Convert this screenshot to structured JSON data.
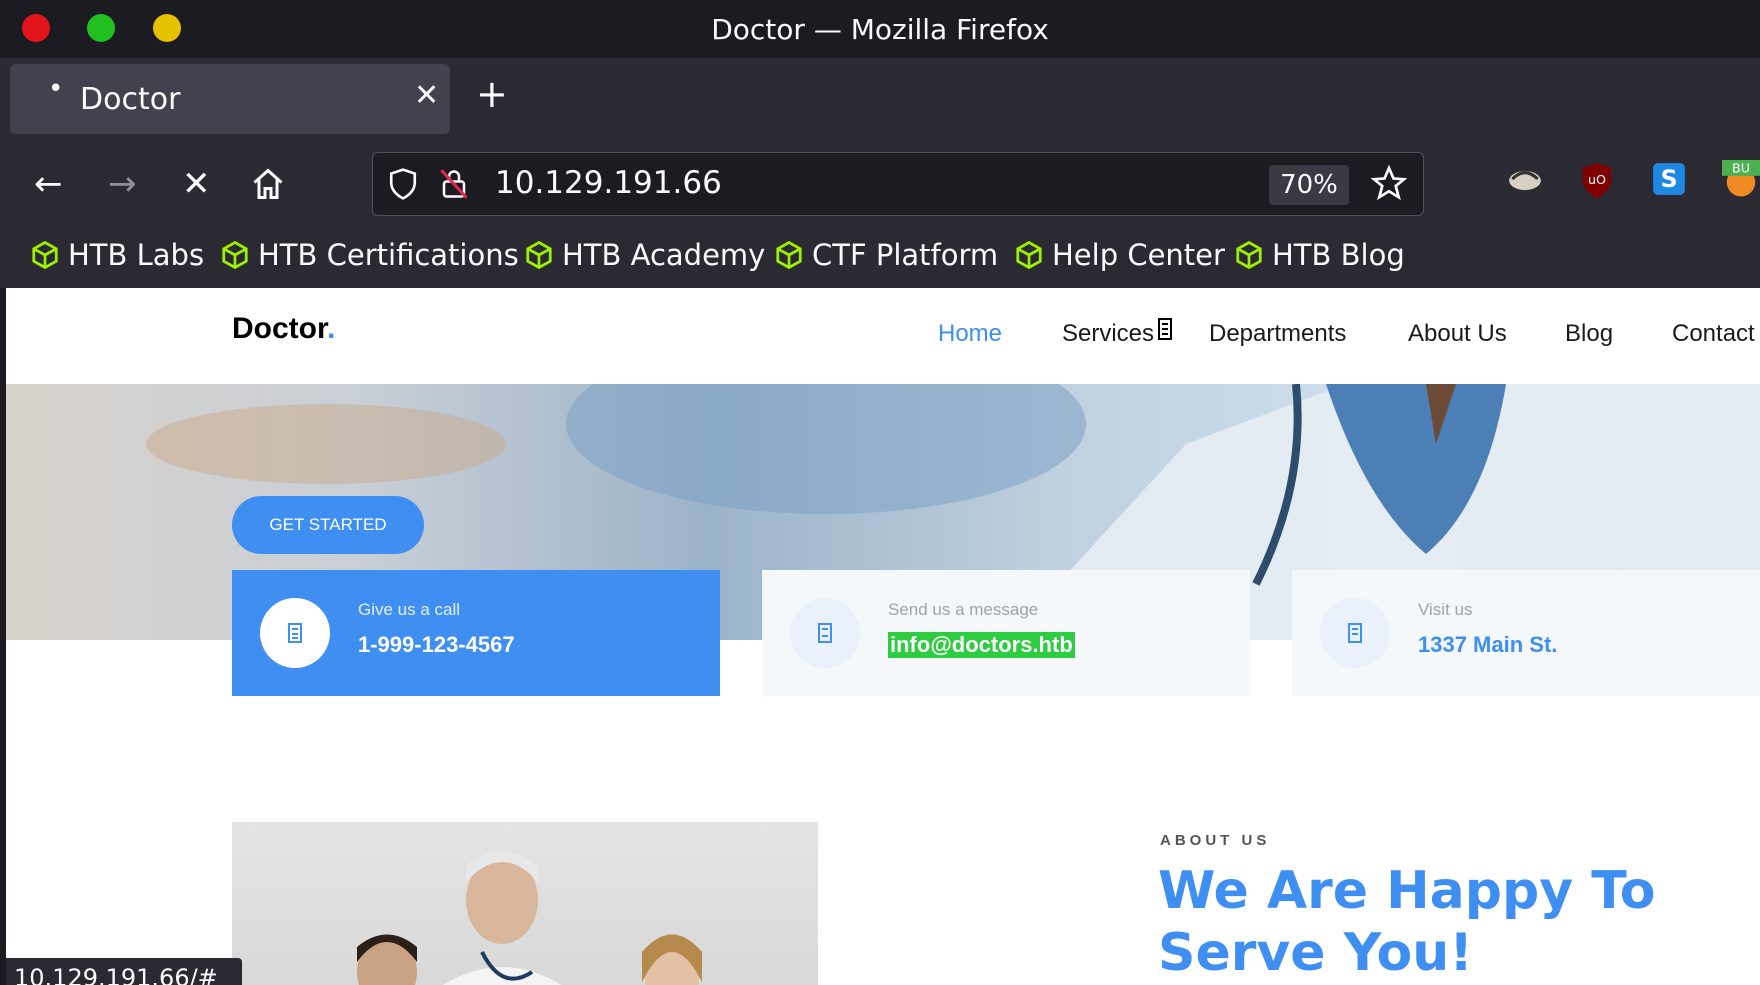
{
  "window": {
    "title": "Doctor — Mozilla Firefox"
  },
  "tab": {
    "title": "Doctor",
    "dot": "•",
    "close_glyph": "✕",
    "new_tab_glyph": "+"
  },
  "toolbar": {
    "back_glyph": "←",
    "forward_glyph": "→",
    "stop_glyph": "✕",
    "home_icon": "home-icon",
    "url": "10.129.191.66",
    "zoom": "70%"
  },
  "bookmarks": [
    "HTB Labs",
    "HTB Certifications",
    "HTB Academy",
    "CTF Platform",
    "Help Center",
    "HTB Blog"
  ],
  "site": {
    "brand": "Doctor",
    "brand_dot": ".",
    "nav": [
      "Home",
      "Services",
      "Departments",
      "About Us",
      "Blog",
      "Contact"
    ],
    "get_started": "GET STARTED",
    "cards": [
      {
        "label": "Give us a call",
        "value": "1-999-123-4567"
      },
      {
        "label": "Send us a message",
        "value": "info@doctors.htb"
      },
      {
        "label": "Visit us",
        "value": "1337 Main St."
      }
    ],
    "about_tag": "ABOUT US",
    "about_title": "We Are Happy To Serve You!"
  },
  "status_url": "10.129.191.66/#",
  "colors": {
    "accent": "#3f8ef2",
    "highlight": "#2ecc40",
    "htb_green": "#9fef00"
  }
}
